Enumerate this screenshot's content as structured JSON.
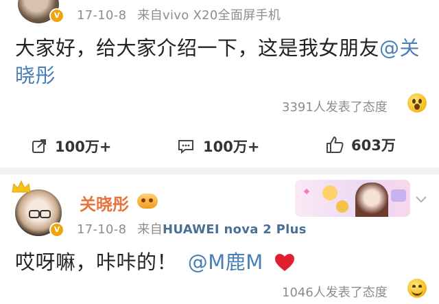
{
  "post1": {
    "meta": {
      "date": "17-10-8",
      "source_prefix": "来自",
      "device": "vivo X20全面屏手机"
    },
    "text": {
      "line1": "大家好，给大家介绍一下，这是我女朋友",
      "mention_part1": "@关",
      "line2": "晓彤"
    },
    "reactions": {
      "count_text": "3391人发表了态度",
      "emoji": "surprised-emoji"
    },
    "actions": {
      "share": {
        "icon": "share-icon",
        "label": "100万+"
      },
      "comment": {
        "icon": "comment-icon",
        "label": "100万+"
      },
      "like": {
        "icon": "thumbs-up-icon",
        "label": "603万"
      }
    }
  },
  "post2": {
    "author": {
      "name": "关晓彤",
      "verified": true
    },
    "meta": {
      "date": "17-10-8",
      "source_prefix": "来自",
      "device": "HUAWEI nova 2 Plus"
    },
    "text": {
      "main": "哎呀嘛，咔咔的！",
      "mention": "@M鹿M"
    },
    "reactions": {
      "count_text": "1046人发表了态度",
      "emoji": "grin-emoji"
    }
  },
  "colors": {
    "mention": "#4a7eb8",
    "author_name": "#e8743b",
    "meta_gray": "#8c8c8c",
    "badge_orange": "#f0a30a",
    "heart_red": "#e0202e"
  }
}
